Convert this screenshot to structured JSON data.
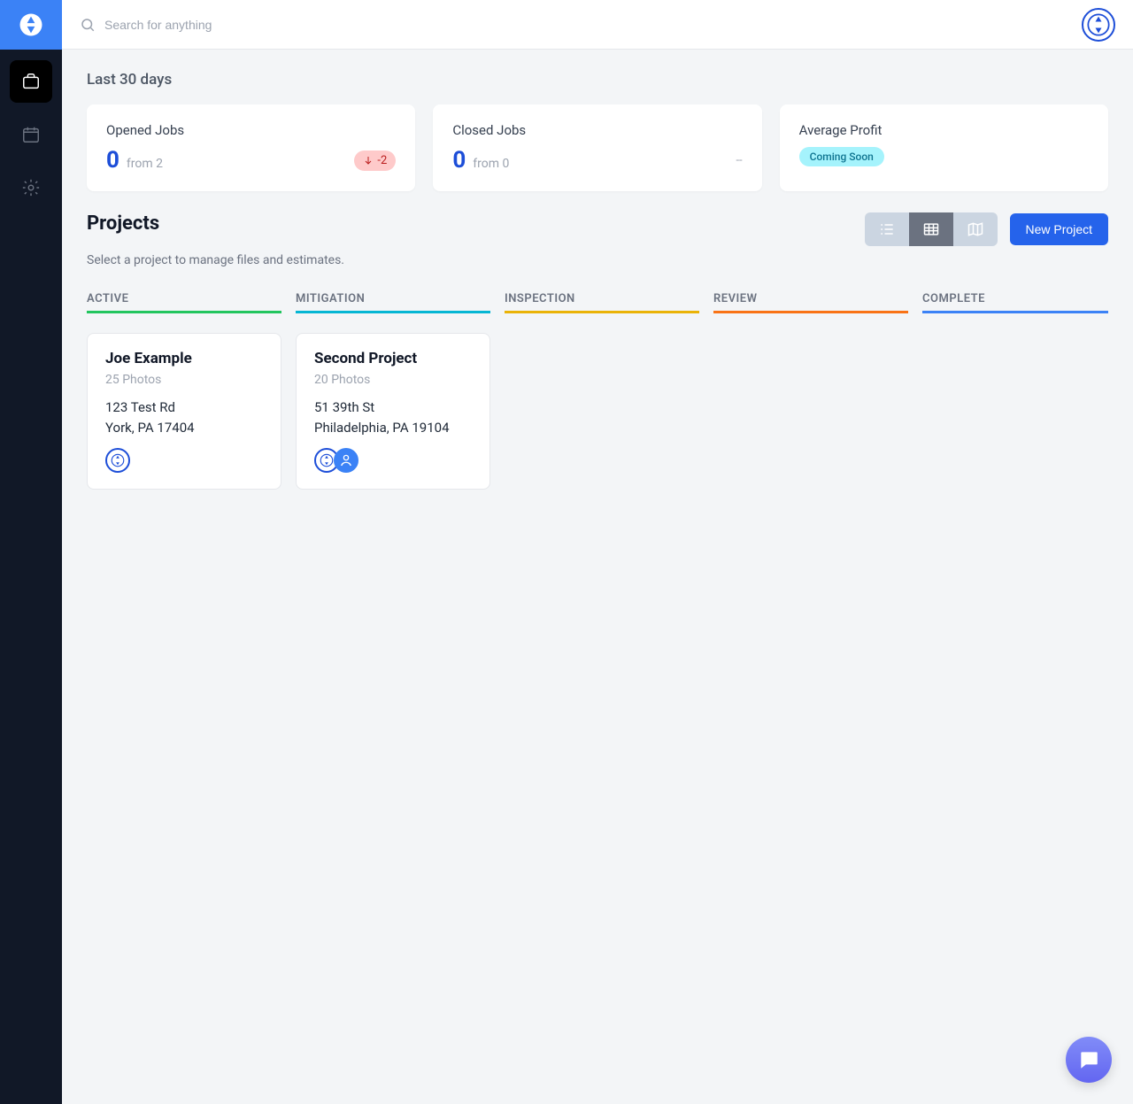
{
  "search": {
    "placeholder": "Search for anything"
  },
  "overview": {
    "period_label": "Last 30 days",
    "cards": {
      "opened": {
        "title": "Opened Jobs",
        "value": "0",
        "from_label": "from 2",
        "delta": "-2"
      },
      "closed": {
        "title": "Closed Jobs",
        "value": "0",
        "from_label": "from 0",
        "right_value": "--"
      },
      "profit": {
        "title": "Average Profit",
        "badge": "Coming Soon"
      }
    }
  },
  "projects": {
    "heading": "Projects",
    "subheading": "Select a project to manage files and estimates.",
    "new_button": "New Project",
    "columns": {
      "active": "ACTIVE",
      "mitigation": "MITIGATION",
      "inspection": "INSPECTION",
      "review": "REVIEW",
      "complete": "COMPLETE"
    },
    "active_card": {
      "name": "Joe Example",
      "photos": "25 Photos",
      "addr1": "123 Test Rd",
      "addr2": "York, PA 17404"
    },
    "mitigation_card": {
      "name": "Second Project",
      "photos": "20 Photos",
      "addr1": "51 39th St",
      "addr2": "Philadelphia, PA 19104"
    }
  }
}
